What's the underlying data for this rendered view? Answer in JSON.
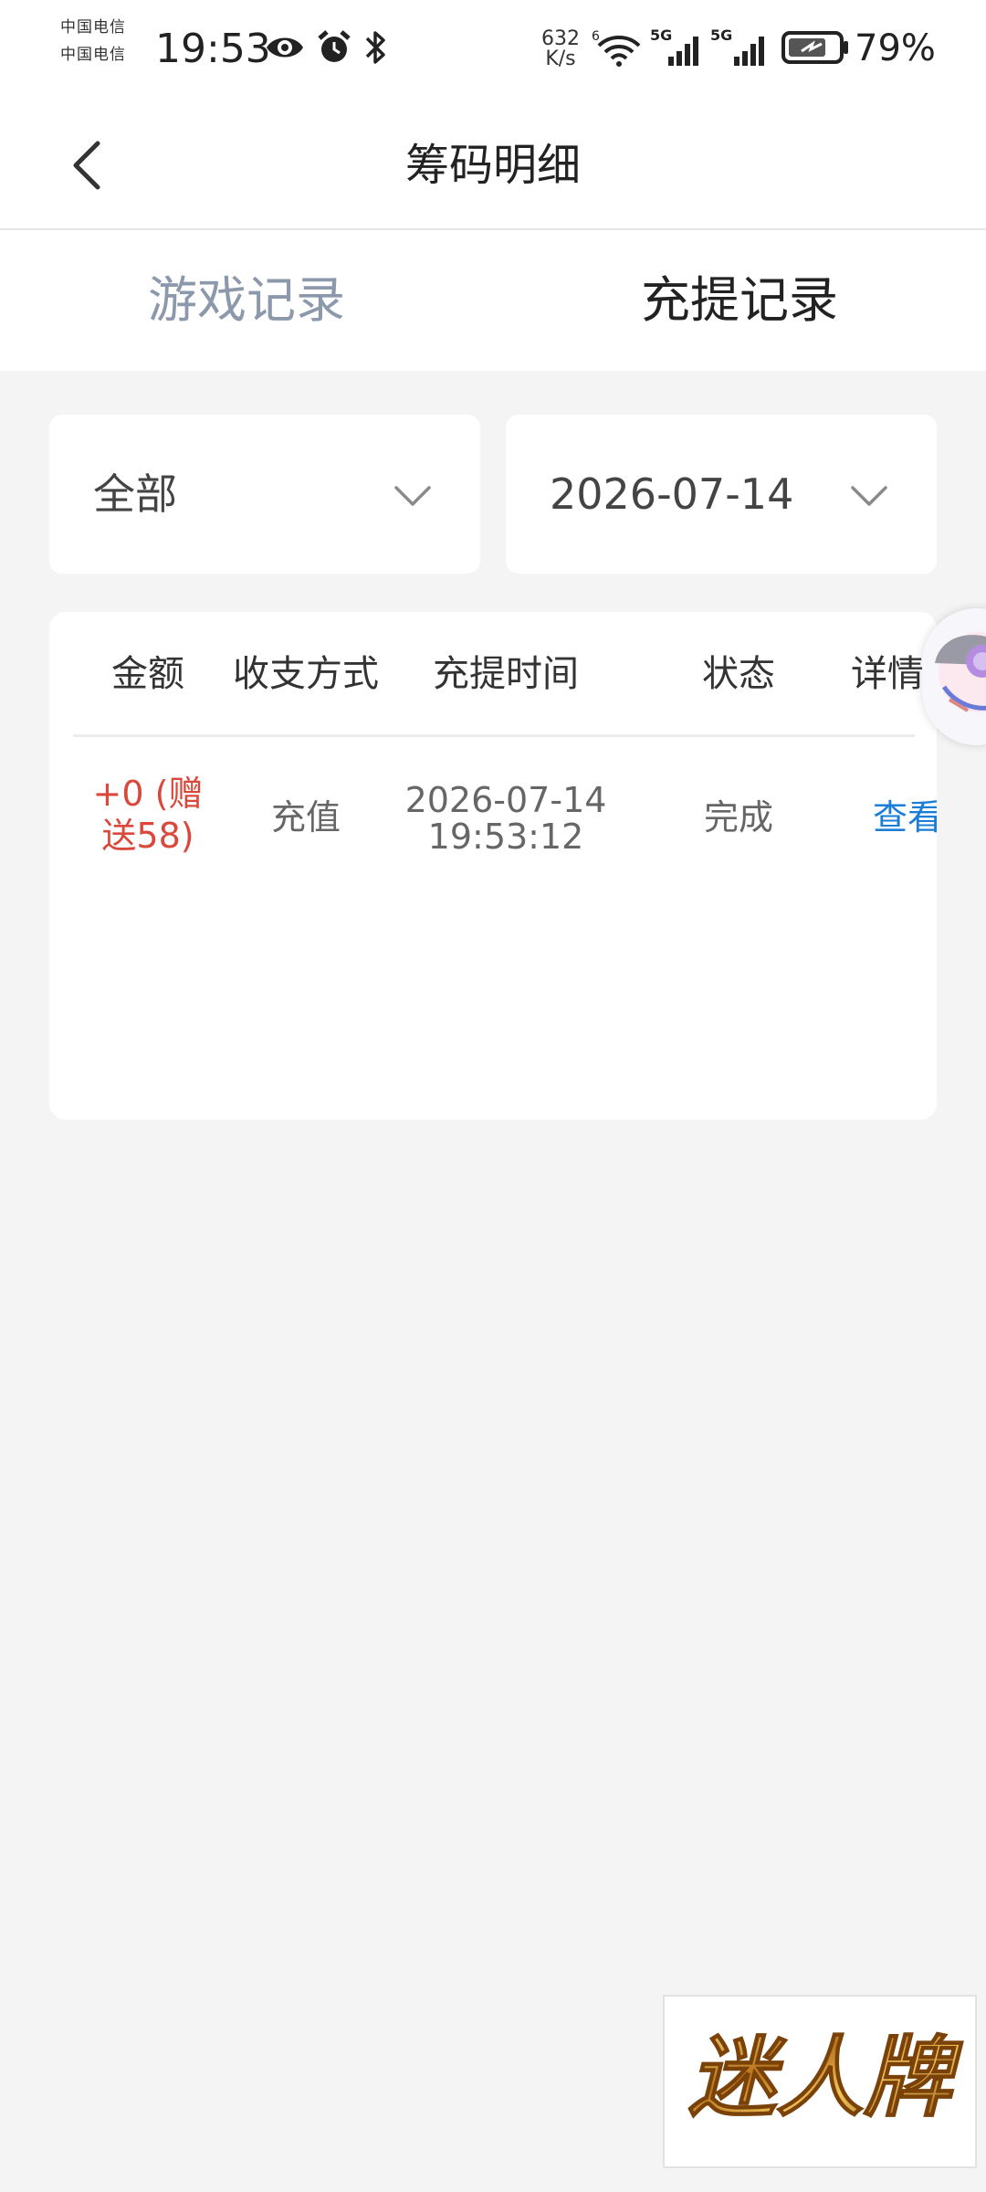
{
  "status_bar": {
    "carrier_line1": "中国电信",
    "carrier_line2": "中国电信",
    "time": "19:53",
    "net_speed_value": "632",
    "net_speed_unit": "K/s",
    "battery_percent": "79%",
    "icons": [
      "eye-icon",
      "alarm-icon",
      "bluetooth-icon",
      "wifi-icon",
      "signal-5g-icon",
      "signal-5g-icon",
      "battery-charging-icon"
    ]
  },
  "header": {
    "title": "筹码明细",
    "back_icon": "chevron-left-icon"
  },
  "tabs": [
    {
      "label": "游戏记录",
      "active": false
    },
    {
      "label": "充提记录",
      "active": true
    }
  ],
  "filters": {
    "type": {
      "value": "全部"
    },
    "date": {
      "value": "2026-07-14"
    }
  },
  "table": {
    "columns": [
      "金额",
      "收支方式",
      "充提时间",
      "状态",
      "详情"
    ],
    "rows": [
      {
        "amount": "+0 (赠送58)",
        "method": "充值",
        "date": "2026-07-14",
        "time": "19:53:12",
        "status": "完成",
        "detail": "查看"
      }
    ]
  },
  "colors": {
    "amount_red": "#d9483b",
    "link_blue": "#1a7ed6",
    "inactive_tab": "#8c98ac",
    "page_bg": "#f4f4f4"
  },
  "logo": {
    "text": "迷人牌"
  }
}
